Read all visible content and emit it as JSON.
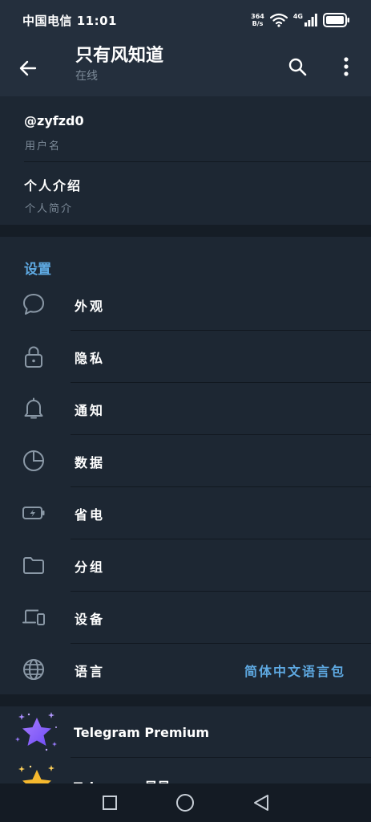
{
  "status_bar": {
    "carrier": "中国电信",
    "time": "11:01",
    "net_speed_value": "364",
    "net_speed_unit": "B/s",
    "signal_type": "4G"
  },
  "header": {
    "title": "只有风知道",
    "subtitle": "在线"
  },
  "info": {
    "username_value": "@zyfzd0",
    "username_label": "用户名",
    "bio_value": "个人介绍",
    "bio_label": "个人简介"
  },
  "settings": {
    "header": "设置",
    "items": [
      {
        "label": "外观",
        "icon": "chat-bubble-icon"
      },
      {
        "label": "隐私",
        "icon": "lock-icon"
      },
      {
        "label": "通知",
        "icon": "bell-icon"
      },
      {
        "label": "数据",
        "icon": "pie-chart-icon"
      },
      {
        "label": "省电",
        "icon": "battery-icon"
      },
      {
        "label": "分组",
        "icon": "folder-icon"
      },
      {
        "label": "设备",
        "icon": "devices-icon"
      },
      {
        "label": "语言",
        "icon": "globe-icon",
        "value": "简体中文语言包"
      }
    ]
  },
  "premium": {
    "items": [
      {
        "label": "Telegram Premium",
        "icon": "premium-star-icon"
      },
      {
        "label": "Telegram 星星",
        "icon": "gold-star-icon"
      }
    ]
  },
  "colors": {
    "accent": "#5ea9e2",
    "background": "#1d2733",
    "header_bg": "#242f3d",
    "secondary_text": "#7d8b99"
  }
}
